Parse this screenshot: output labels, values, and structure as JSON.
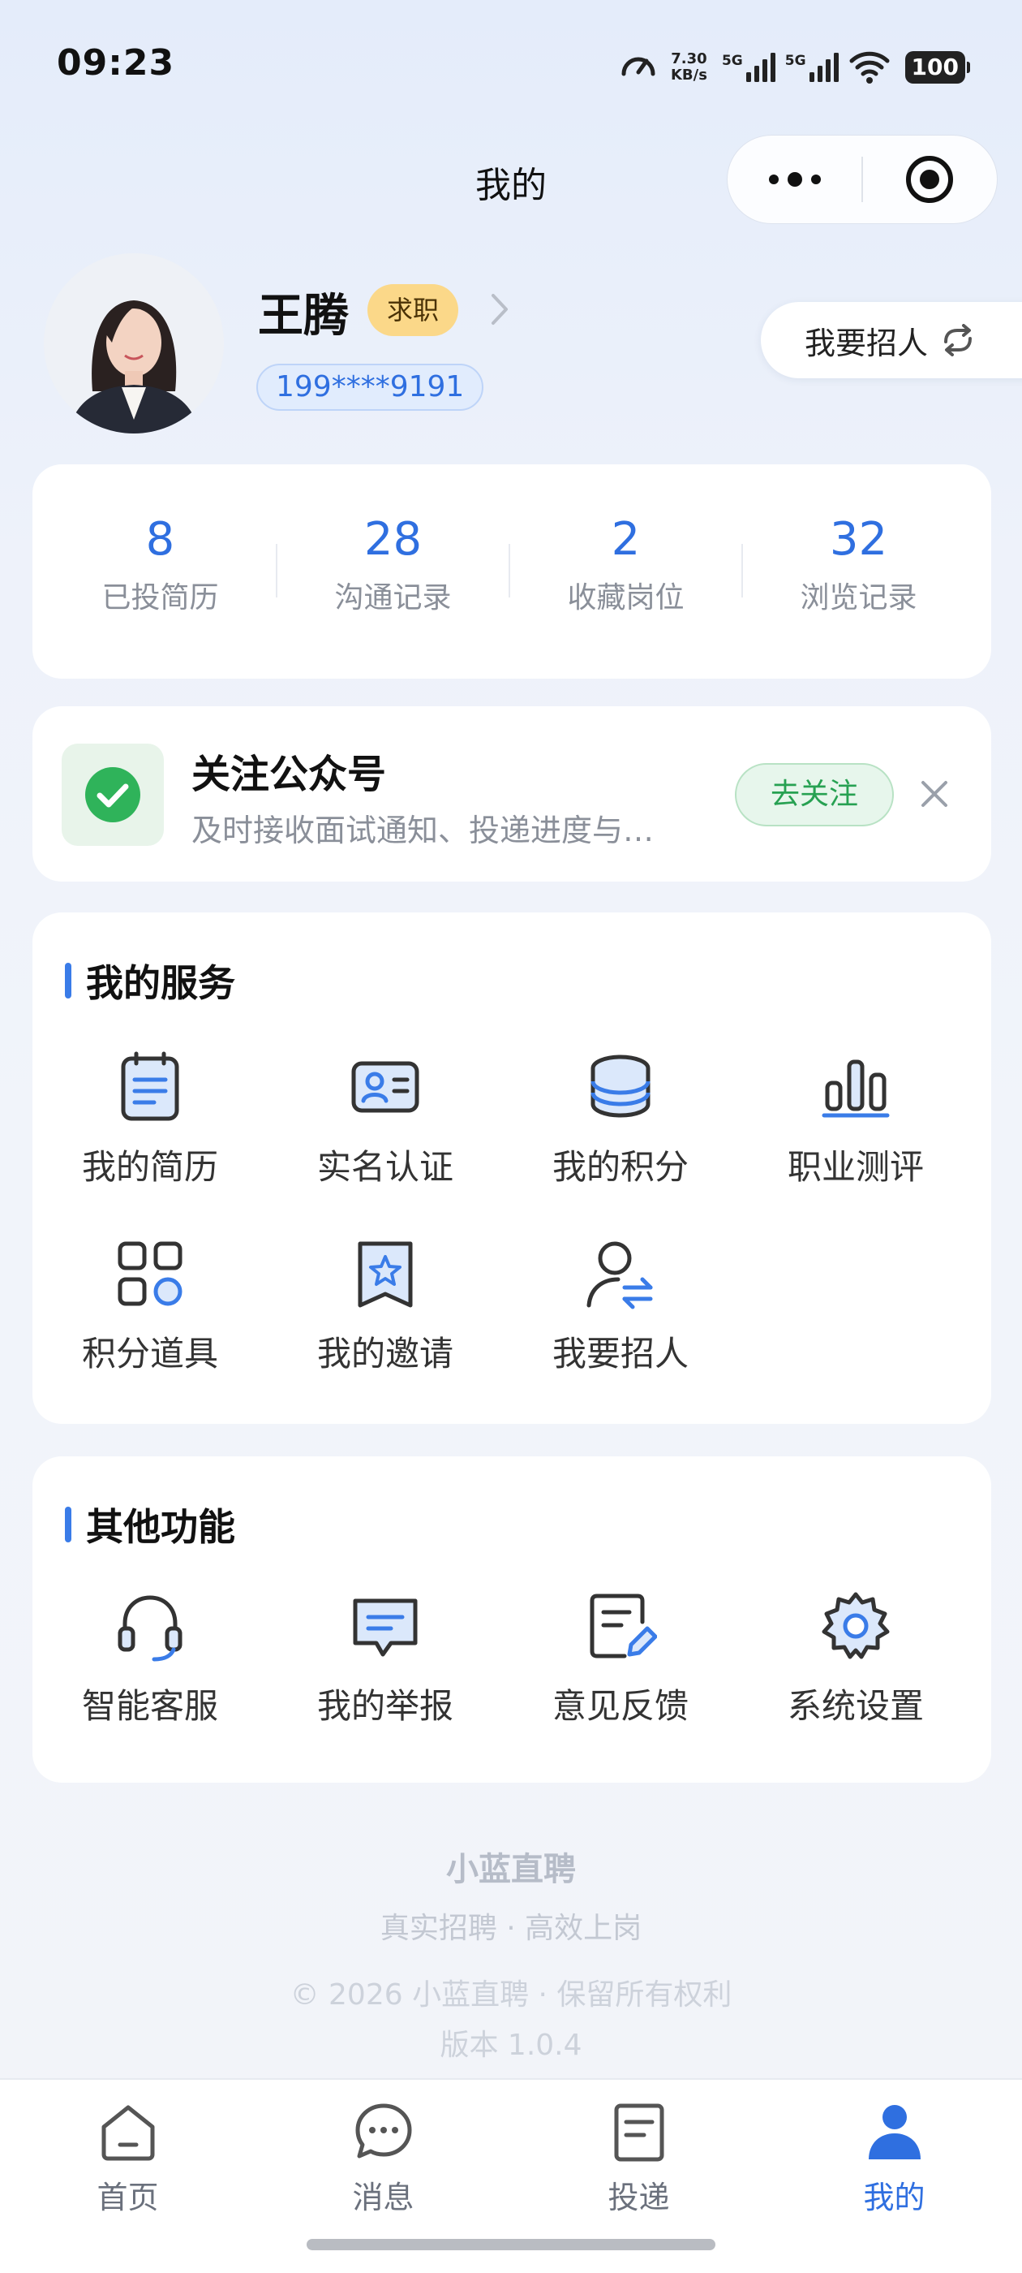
{
  "status_bar": {
    "time": "09:23",
    "speed_value": "7.30",
    "speed_unit": "KB/s",
    "sim1_label": "5G",
    "sim2_label": "5G",
    "battery": "100"
  },
  "nav": {
    "title": "我的"
  },
  "profile": {
    "name": "王腾",
    "status_badge": "求职",
    "phone": "199****9191",
    "switch_role_label": "我要招人"
  },
  "stats": [
    {
      "value": "8",
      "label": "已投简历"
    },
    {
      "value": "28",
      "label": "沟通记录"
    },
    {
      "value": "2",
      "label": "收藏岗位"
    },
    {
      "value": "32",
      "label": "浏览记录"
    }
  ],
  "follow_banner": {
    "title": "关注公众号",
    "description": "及时接收面试通知、投递进度与…",
    "button_label": "去关注"
  },
  "my_services": {
    "title": "我的服务",
    "items": [
      {
        "label": "我的简历",
        "icon": "resume-icon"
      },
      {
        "label": "实名认证",
        "icon": "id-card-icon"
      },
      {
        "label": "我的积分",
        "icon": "coins-icon"
      },
      {
        "label": "职业测评",
        "icon": "bar-chart-icon"
      },
      {
        "label": "积分道具",
        "icon": "grid-tools-icon"
      },
      {
        "label": "我的邀请",
        "icon": "invite-star-icon"
      },
      {
        "label": "我要招人",
        "icon": "user-switch-icon"
      }
    ]
  },
  "other_functions": {
    "title": "其他功能",
    "items": [
      {
        "label": "智能客服",
        "icon": "headset-icon"
      },
      {
        "label": "我的举报",
        "icon": "report-chat-icon"
      },
      {
        "label": "意见反馈",
        "icon": "feedback-edit-icon"
      },
      {
        "label": "系统设置",
        "icon": "gear-icon"
      }
    ]
  },
  "footer": {
    "brand": "小蓝直聘",
    "slogan": "真实招聘 · 高效上岗",
    "copyright": "© 2026 小蓝直聘 · 保留所有权利",
    "version": "版本 1.0.4"
  },
  "tabbar": [
    {
      "label": "首页",
      "icon": "home-icon"
    },
    {
      "label": "消息",
      "icon": "message-icon"
    },
    {
      "label": "投递",
      "icon": "document-icon"
    },
    {
      "label": "我的",
      "icon": "user-icon",
      "active": true
    }
  ],
  "colors": {
    "accent": "#2f6fe0",
    "job_badge": "#fbd889",
    "wechat_green": "#27a152"
  }
}
